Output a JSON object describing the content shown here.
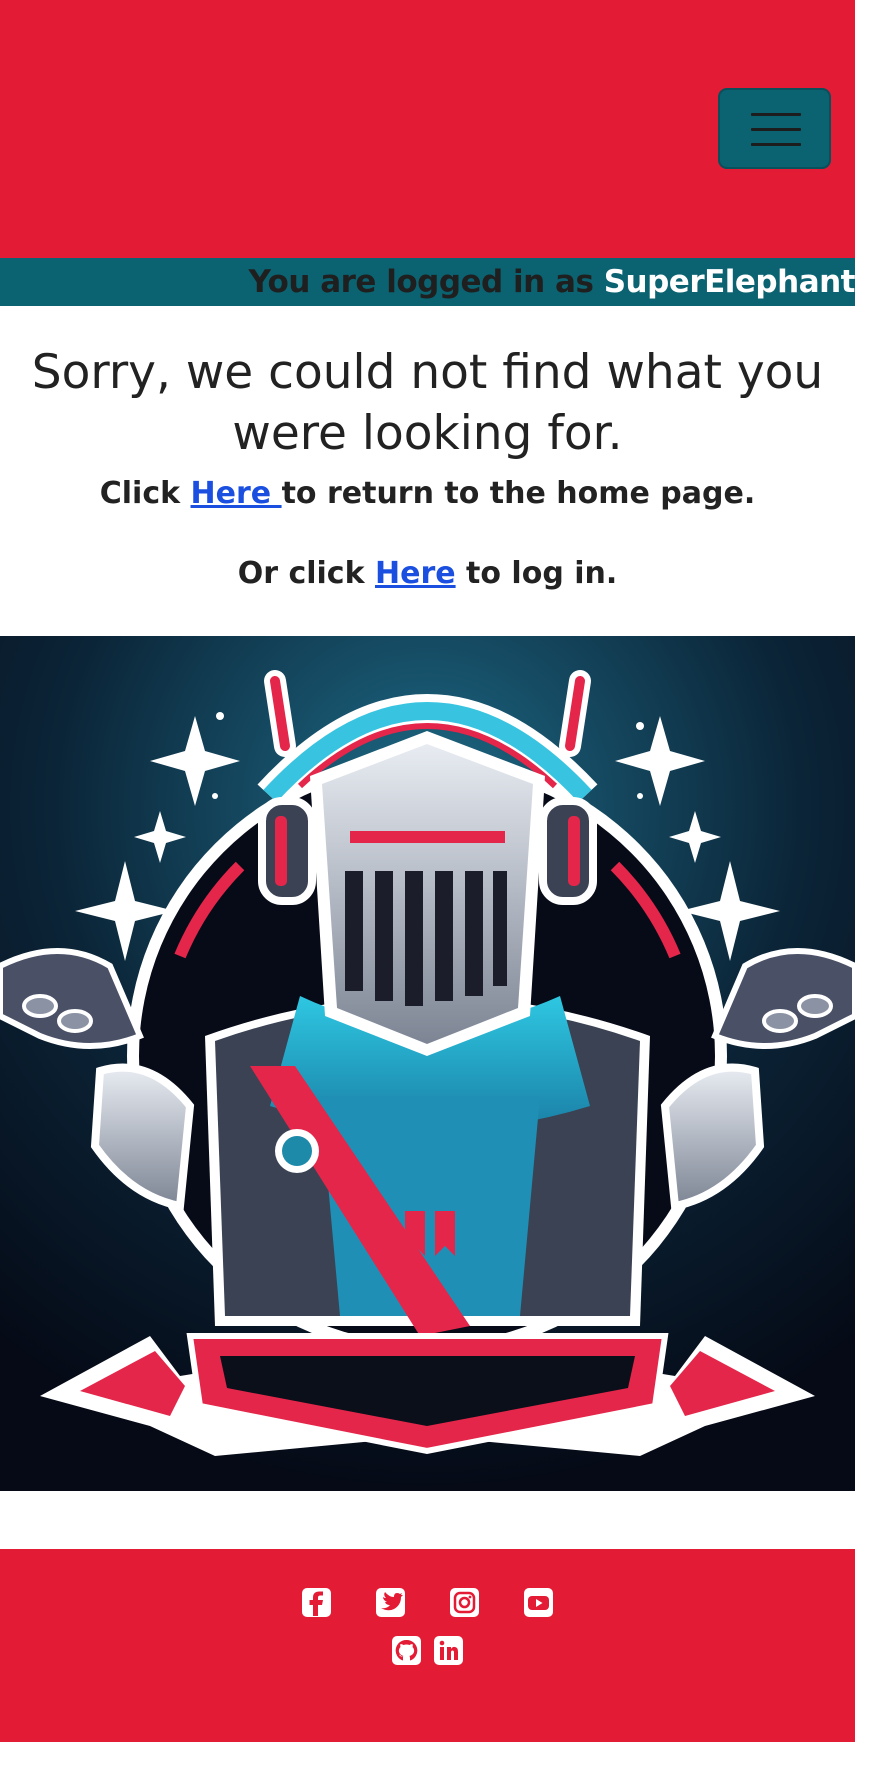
{
  "header": {
    "background_color": "#e41b35",
    "menu_icon": "hamburger-menu-icon"
  },
  "login_banner": {
    "prefix": "You are logged in as",
    "username": "SuperElephant",
    "background_color": "#0b6270"
  },
  "error": {
    "title": "Sorry, we could not find what you were looking for.",
    "line1_before": "Click ",
    "line1_link": "Here ",
    "line1_after": "to return to the home page.",
    "line2_before": "Or click ",
    "line2_link": "Here",
    "line2_after": " to log in.",
    "link_color": "#1a4fe0"
  },
  "illustration": {
    "subject": "knight-shrugging-illustration"
  },
  "footer": {
    "background_color": "#e41b35",
    "social_icons": [
      "facebook-icon",
      "twitter-icon",
      "instagram-icon",
      "youtube-icon",
      "github-icon",
      "linkedin-icon"
    ]
  }
}
